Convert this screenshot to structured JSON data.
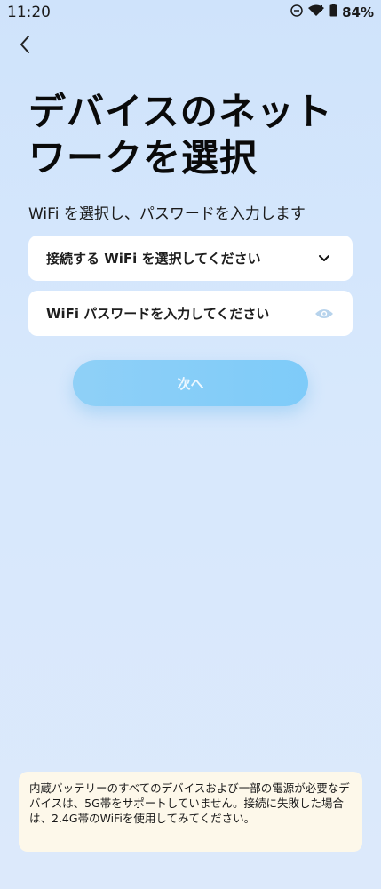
{
  "status_bar": {
    "time": "11:20",
    "battery_percent": "84%",
    "icons": [
      "do-not-disturb-icon",
      "wifi-icon",
      "battery-icon"
    ]
  },
  "header": {
    "back_icon": "chevron-left-icon"
  },
  "main": {
    "title": "デバイスのネットワークを選択",
    "subtitle": "WiFi を選択し、パスワードを入力します",
    "wifi_select": {
      "placeholder": "接続する WiFi を選択してください",
      "icon": "chevron-down-icon"
    },
    "password_field": {
      "placeholder": "WiFi パスワードを入力してください",
      "icon": "eye-icon"
    },
    "next_button_label": "次へ"
  },
  "notice": {
    "text": "内蔵バッテリーのすべてのデバイスおよび一部の電源が必要なデバイスは、5G帯をサポートしていません。接続に失敗した場合は、2.4G帯のWiFiを使用してみてください。"
  },
  "colors": {
    "background": "#d5e7fb",
    "field_background": "#ffffff",
    "button": "#7ecbf9",
    "notice_background": "#fdf8ea"
  }
}
